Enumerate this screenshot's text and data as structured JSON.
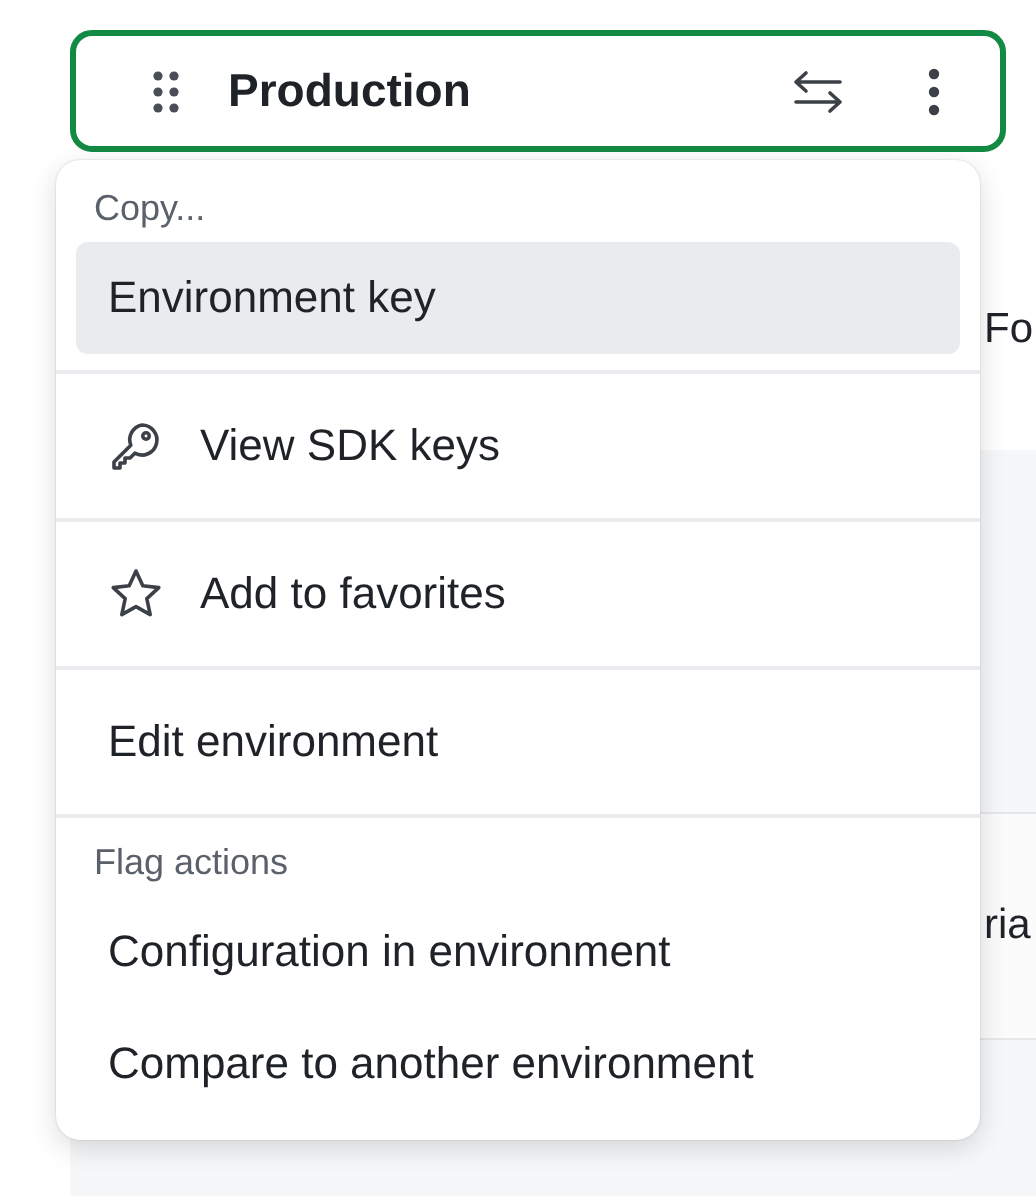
{
  "environment_header": {
    "title": "Production"
  },
  "background_page": {
    "heading_fragment": "Fo",
    "row_fragment": "ria"
  },
  "menu": {
    "sections": [
      {
        "heading": "Copy...",
        "items": [
          {
            "label": "Environment key",
            "kind": "plain",
            "selected": true
          }
        ]
      },
      {
        "items": [
          {
            "label": "View SDK keys",
            "kind": "key",
            "selected": false
          }
        ]
      },
      {
        "items": [
          {
            "label": "Add to favorites",
            "kind": "star",
            "selected": false
          }
        ]
      },
      {
        "items": [
          {
            "label": "Edit environment",
            "kind": "plain",
            "selected": false
          }
        ]
      },
      {
        "heading": "Flag actions",
        "items": [
          {
            "label": "Configuration in environment",
            "kind": "plain",
            "selected": false
          },
          {
            "label": "Compare to another environment",
            "kind": "plain",
            "selected": false
          }
        ]
      }
    ]
  }
}
